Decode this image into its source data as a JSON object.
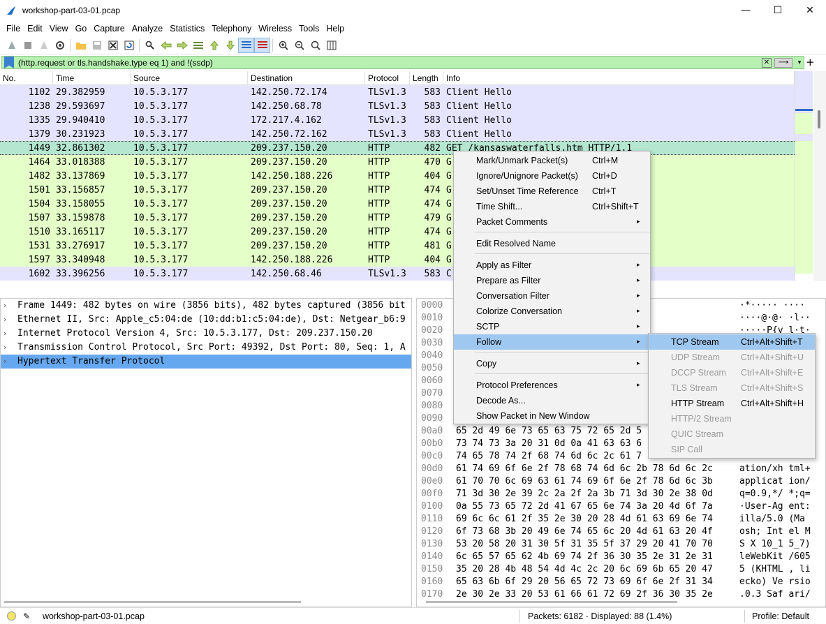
{
  "window": {
    "title": "workshop-part-03-01.pcap",
    "minimize": "—",
    "maximize": "☐",
    "close": "✕"
  },
  "menu": [
    "File",
    "Edit",
    "View",
    "Go",
    "Capture",
    "Analyze",
    "Statistics",
    "Telephony",
    "Wireless",
    "Tools",
    "Help"
  ],
  "filter": {
    "text": "(http.request or tls.handshake.type eq 1) and !(ssdp)",
    "clear": "✕",
    "apply": "⟶",
    "dropdown": "▾",
    "add": "+"
  },
  "columns": [
    "No.",
    "Time",
    "Source",
    "Destination",
    "Protocol",
    "Length",
    "Info"
  ],
  "packets": [
    {
      "no": "1102",
      "time": "29.382959",
      "src": "10.5.3.177",
      "dst": "142.250.72.174",
      "proto": "TLSv1.3",
      "len": "583",
      "info": "Client Hello",
      "cls": "tls"
    },
    {
      "no": "1238",
      "time": "29.593697",
      "src": "10.5.3.177",
      "dst": "142.250.68.78",
      "proto": "TLSv1.3",
      "len": "583",
      "info": "Client Hello",
      "cls": "tls"
    },
    {
      "no": "1335",
      "time": "29.940410",
      "src": "10.5.3.177",
      "dst": "172.217.4.162",
      "proto": "TLSv1.3",
      "len": "583",
      "info": "Client Hello",
      "cls": "tls"
    },
    {
      "no": "1379",
      "time": "30.231923",
      "src": "10.5.3.177",
      "dst": "142.250.72.162",
      "proto": "TLSv1.3",
      "len": "583",
      "info": "Client Hello",
      "cls": "tls"
    },
    {
      "no": "1449",
      "time": "32.861302",
      "src": "10.5.3.177",
      "dst": "209.237.150.20",
      "proto": "HTTP",
      "len": "482",
      "info": "GET /kansaswaterfalls.htm HTTP/1.1",
      "cls": "selrow"
    },
    {
      "no": "1464",
      "time": "33.018388",
      "src": "10.5.3.177",
      "dst": "209.237.150.20",
      "proto": "HTTP",
      "len": "470",
      "info": "G",
      "cls": "http"
    },
    {
      "no": "1482",
      "time": "33.137869",
      "src": "10.5.3.177",
      "dst": "142.250.188.226",
      "proto": "HTTP",
      "len": "404",
      "info": "G",
      "cls": "http"
    },
    {
      "no": "1501",
      "time": "33.156857",
      "src": "10.5.3.177",
      "dst": "209.237.150.20",
      "proto": "HTTP",
      "len": "474",
      "info": "G",
      "cls": "http"
    },
    {
      "no": "1504",
      "time": "33.158055",
      "src": "10.5.3.177",
      "dst": "209.237.150.20",
      "proto": "HTTP",
      "len": "474",
      "info": "G",
      "cls": "http"
    },
    {
      "no": "1507",
      "time": "33.159878",
      "src": "10.5.3.177",
      "dst": "209.237.150.20",
      "proto": "HTTP",
      "len": "479",
      "info": "G                                   1",
      "cls": "http"
    },
    {
      "no": "1510",
      "time": "33.165117",
      "src": "10.5.3.177",
      "dst": "209.237.150.20",
      "proto": "HTTP",
      "len": "474",
      "info": "G",
      "cls": "http"
    },
    {
      "no": "1531",
      "time": "33.276917",
      "src": "10.5.3.177",
      "dst": "209.237.150.20",
      "proto": "HTTP",
      "len": "481",
      "info": "G                                    /1.1",
      "cls": "http"
    },
    {
      "no": "1597",
      "time": "33.340948",
      "src": "10.5.3.177",
      "dst": "142.250.188.226",
      "proto": "HTTP",
      "len": "404",
      "info": "G",
      "cls": "http"
    },
    {
      "no": "1602",
      "time": "33.396256",
      "src": "10.5.3.177",
      "dst": "142.250.68.46",
      "proto": "TLSv1.3",
      "len": "583",
      "info": "C",
      "cls": "tls"
    }
  ],
  "details": [
    "Frame 1449: 482 bytes on wire (3856 bits), 482 bytes captured (3856 bit",
    "Ethernet II, Src: Apple_c5:04:de (10:dd:b1:c5:04:de), Dst: Netgear_b6:9",
    "Internet Protocol Version 4, Src: 10.5.3.177, Dst: 209.237.150.20",
    "Transmission Control Protocol, Src Port: 49392, Dst Port: 80, Seq: 1, A",
    "Hypertext Transfer Protocol"
  ],
  "hex": [
    {
      "off": "0000",
      "bytes": "                                 e 08 00 45 00",
      "asc": "·*····· ····"
    },
    {
      "off": "0010",
      "bytes": "                                 5 03 b1 d1 ed",
      "asc": "····@·@· ·l··"
    },
    {
      "off": "0020",
      "bytes": "                                 e 31 2a 80 18",
      "asc": "·····P{y l·t·"
    },
    {
      "off": "0030",
      "bytes": "",
      "asc": ""
    },
    {
      "off": "0040",
      "bytes": "",
      "asc": ""
    },
    {
      "off": "0050",
      "bytes": "",
      "asc": ""
    },
    {
      "off": "0060",
      "bytes": "",
      "asc": ""
    },
    {
      "off": "0070",
      "bytes": "",
      "asc": ""
    },
    {
      "off": "0080",
      "bytes": "",
      "asc": ""
    },
    {
      "off": "0090",
      "bytes": "",
      "asc": ""
    },
    {
      "off": "00a0",
      "bytes": "65 2d 49 6e 73 65 63 75  72 65 2d 5",
      "asc": ""
    },
    {
      "off": "00b0",
      "bytes": "73 74 73 3a 20 31 0d 0a  41 63 63 6",
      "asc": ""
    },
    {
      "off": "00c0",
      "bytes": "74 65 78 74 2f 68 74 6d  6c 2c 61 7",
      "asc": ""
    },
    {
      "off": "00d0",
      "bytes": "61 74 69 6f 6e 2f 78 68  74 6d 6c 2b 78 6d 6c 2c",
      "asc": "ation/xh tml+"
    },
    {
      "off": "00e0",
      "bytes": "61 70 70 6c 69 63 61 74  69 6f 6e 2f 78 6d 6c 3b",
      "asc": "applicat ion/"
    },
    {
      "off": "00f0",
      "bytes": "71 3d 30 2e 39 2c 2a 2f  2a 3b 71 3d 30 2e 38 0d",
      "asc": "q=0.9,*/ *;q="
    },
    {
      "off": "0100",
      "bytes": "0a 55 73 65 72 2d 41 67  65 6e 74 3a 20 4d 6f 7a",
      "asc": "·User-Ag ent:"
    },
    {
      "off": "0110",
      "bytes": "69 6c 6c 61 2f 35 2e 30  20 28 4d 61 63 69 6e 74",
      "asc": "illa/5.0  (Ma"
    },
    {
      "off": "0120",
      "bytes": "6f 73 68 3b 20 49 6e 74  65 6c 20 4d 61 63 20 4f",
      "asc": "osh; Int el M"
    },
    {
      "off": "0130",
      "bytes": "53 20 58 20 31 30 5f 31  35 5f 37 29 20 41 70 70",
      "asc": "S X 10_1 5_7)"
    },
    {
      "off": "0140",
      "bytes": "6c 65 57 65 62 4b 69 74  2f 36 30 35 2e 31 2e 31",
      "asc": "leWebKit /605"
    },
    {
      "off": "0150",
      "bytes": "35 20 28 4b 48 54 4d 4c  2c 20 6c 69 6b 65 20 47",
      "asc": "5 (KHTML , li"
    },
    {
      "off": "0160",
      "bytes": "65 63 6b 6f 29 20 56 65  72 73 69 6f 6e 2f 31 34",
      "asc": "ecko) Ve rsio"
    },
    {
      "off": "0170",
      "bytes": "2e 30 2e 33 20 53 61 66  61 72 69 2f 36 30 35 2e",
      "asc": ".0.3 Saf ari/"
    }
  ],
  "context_menu": [
    {
      "label": "Mark/Unmark Packet(s)",
      "shortcut": "Ctrl+M"
    },
    {
      "label": "Ignore/Unignore Packet(s)",
      "shortcut": "Ctrl+D"
    },
    {
      "label": "Set/Unset Time Reference",
      "shortcut": "Ctrl+T"
    },
    {
      "label": "Time Shift...",
      "shortcut": "Ctrl+Shift+T"
    },
    {
      "label": "Packet Comments",
      "arrow": "▸"
    },
    {
      "label": "Edit Resolved Name"
    },
    {
      "label": "Apply as Filter",
      "arrow": "▸"
    },
    {
      "label": "Prepare as Filter",
      "arrow": "▸"
    },
    {
      "label": "Conversation Filter",
      "arrow": "▸"
    },
    {
      "label": "Colorize Conversation",
      "arrow": "▸"
    },
    {
      "label": "SCTP",
      "arrow": "▸"
    },
    {
      "label": "Follow",
      "arrow": "▸"
    },
    {
      "label": "Copy",
      "arrow": "▸"
    },
    {
      "label": "Protocol Preferences",
      "arrow": "▸"
    },
    {
      "label": "Decode As..."
    },
    {
      "label": "Show Packet in New Window"
    }
  ],
  "follow_submenu": [
    {
      "label": "TCP Stream",
      "shortcut": "Ctrl+Alt+Shift+T"
    },
    {
      "label": "UDP Stream",
      "shortcut": "Ctrl+Alt+Shift+U"
    },
    {
      "label": "DCCP Stream",
      "shortcut": "Ctrl+Alt+Shift+E"
    },
    {
      "label": "TLS Stream",
      "shortcut": "Ctrl+Alt+Shift+S"
    },
    {
      "label": "HTTP Stream",
      "shortcut": "Ctrl+Alt+Shift+H"
    },
    {
      "label": "HTTP/2 Stream"
    },
    {
      "label": "QUIC Stream"
    },
    {
      "label": "SIP Call"
    }
  ],
  "status": {
    "file": "workshop-part-03-01.pcap",
    "packets": "Packets: 6182 · Displayed: 88 (1.4%)",
    "profile": "Profile: Default"
  },
  "colors": {
    "tls_row": "#e4e4ff",
    "http_row": "#e4ffc7",
    "selected_row": "#b4e6d0",
    "filter_bg": "#b7f0b1",
    "highlight": "#9ec8f0"
  }
}
